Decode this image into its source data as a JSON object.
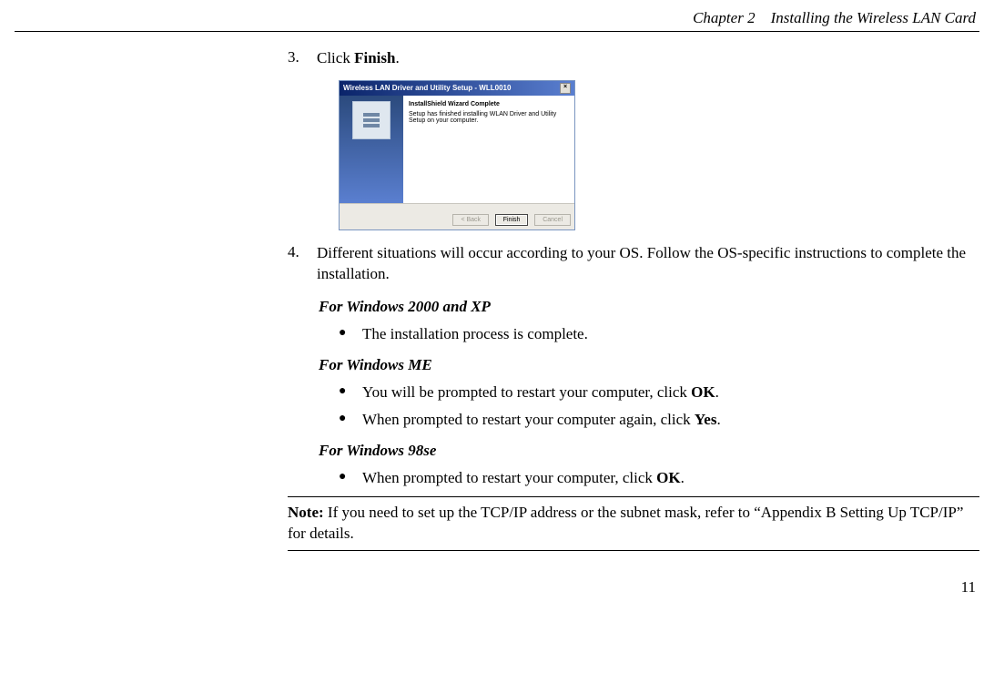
{
  "header": {
    "chapter": "Chapter 2",
    "title": "Installing the Wireless LAN Card"
  },
  "steps": {
    "s3": {
      "num": "3.",
      "pre": "Click ",
      "bold": "Finish",
      "post": "."
    },
    "s4": {
      "num": "4.",
      "text": "Different situations will occur according to your OS. Follow the OS-specific instructions to complete the installation."
    }
  },
  "wizard": {
    "title": "Wireless LAN Driver and Utility Setup - WLL0010",
    "heading": "InstallShield Wizard Complete",
    "body": "Setup has finished installing WLAN Driver and Utility Setup on your computer.",
    "back": "< Back",
    "finish": "Finish",
    "cancel": "Cancel"
  },
  "os": {
    "h1": "For Windows 2000 and XP",
    "b1": "The installation process is complete.",
    "h2": "For Windows ME",
    "b2a_pre": "You will be prompted to restart your computer, click ",
    "b2a_bold": "OK",
    "b2a_post": ".",
    "b2b_pre": "When prompted to restart your computer again, click ",
    "b2b_bold": "Yes",
    "b2b_post": ".",
    "h3": "For Windows 98se",
    "b3_pre": "When prompted to restart your computer, click ",
    "b3_bold": "OK",
    "b3_post": "."
  },
  "note": {
    "label": "Note:",
    "text": " If you need to set up the TCP/IP address or the subnet mask, refer to “Appendix B Setting Up TCP/IP” for details."
  },
  "page_number": "11"
}
